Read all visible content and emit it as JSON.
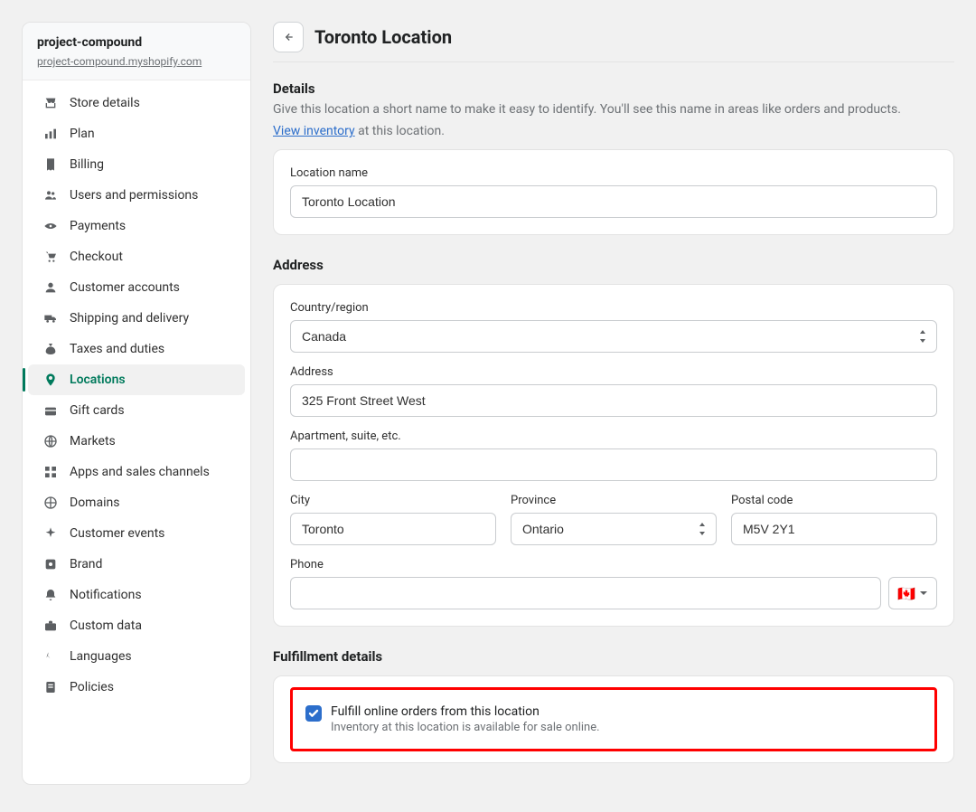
{
  "sidebar": {
    "project": "project-compound",
    "domain": "project-compound.myshopify.com",
    "items": [
      {
        "label": "Store details",
        "icon": "storefront-icon",
        "active": false
      },
      {
        "label": "Plan",
        "icon": "chart-bar-icon",
        "active": false
      },
      {
        "label": "Billing",
        "icon": "receipt-icon",
        "active": false
      },
      {
        "label": "Users and permissions",
        "icon": "users-icon",
        "active": false
      },
      {
        "label": "Payments",
        "icon": "payments-icon",
        "active": false
      },
      {
        "label": "Checkout",
        "icon": "cart-icon",
        "active": false
      },
      {
        "label": "Customer accounts",
        "icon": "person-icon",
        "active": false
      },
      {
        "label": "Shipping and delivery",
        "icon": "truck-icon",
        "active": false
      },
      {
        "label": "Taxes and duties",
        "icon": "money-bag-icon",
        "active": false
      },
      {
        "label": "Locations",
        "icon": "pin-icon",
        "active": true
      },
      {
        "label": "Gift cards",
        "icon": "gift-card-icon",
        "active": false
      },
      {
        "label": "Markets",
        "icon": "globe-icon",
        "active": false
      },
      {
        "label": "Apps and sales channels",
        "icon": "apps-icon",
        "active": false
      },
      {
        "label": "Domains",
        "icon": "domain-globe-icon",
        "active": false
      },
      {
        "label": "Customer events",
        "icon": "sparkle-icon",
        "active": false
      },
      {
        "label": "Brand",
        "icon": "brand-icon",
        "active": false
      },
      {
        "label": "Notifications",
        "icon": "bell-icon",
        "active": false
      },
      {
        "label": "Custom data",
        "icon": "briefcase-icon",
        "active": false
      },
      {
        "label": "Languages",
        "icon": "language-icon",
        "active": false
      },
      {
        "label": "Policies",
        "icon": "policies-icon",
        "active": false
      }
    ]
  },
  "header": {
    "title": "Toronto Location"
  },
  "details": {
    "heading": "Details",
    "subtext": "Give this location a short name to make it easy to identify. You'll see this name in areas like orders and products.",
    "inventory_link": "View inventory",
    "inventory_suffix": " at this location.",
    "location_name_label": "Location name",
    "location_name_value": "Toronto Location"
  },
  "address": {
    "heading": "Address",
    "country_label": "Country/region",
    "country_value": "Canada",
    "address_label": "Address",
    "address_value": "325 Front Street West",
    "apartment_label": "Apartment, suite, etc.",
    "apartment_value": "",
    "city_label": "City",
    "city_value": "Toronto",
    "province_label": "Province",
    "province_value": "Ontario",
    "postal_label": "Postal code",
    "postal_value": "M5V 2Y1",
    "phone_label": "Phone",
    "phone_value": "",
    "phone_flag": "🇨🇦"
  },
  "fulfillment": {
    "heading": "Fulfillment details",
    "checkbox_label": "Fulfill online orders from this location",
    "checkbox_sub": "Inventory at this location is available for sale online."
  }
}
